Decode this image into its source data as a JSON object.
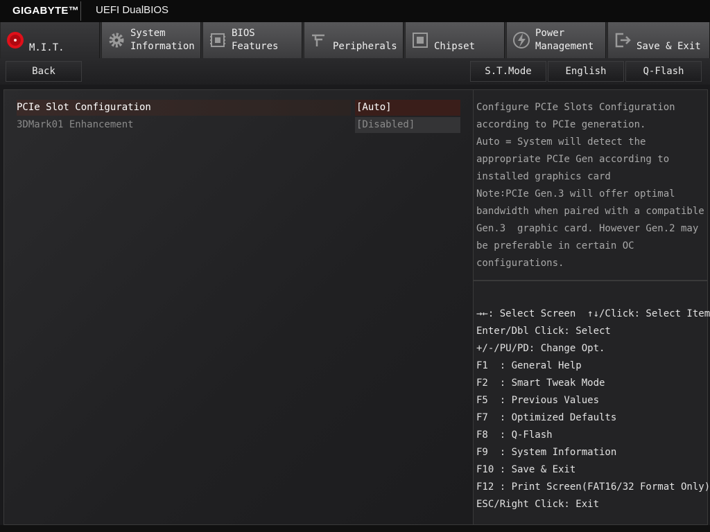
{
  "header": {
    "brand": "GIGABYTE™",
    "product": "UEFI DualBIOS"
  },
  "tabs": [
    {
      "label": "M.I.T.",
      "icon": "mit-dial-icon"
    },
    {
      "label": "System\nInformation",
      "icon": "gear-icon"
    },
    {
      "label": "BIOS\nFeatures",
      "icon": "bios-chip-icon"
    },
    {
      "label": "Peripherals",
      "icon": "peripherals-icon"
    },
    {
      "label": "Chipset",
      "icon": "chipset-icon"
    },
    {
      "label": "Power\nManagement",
      "icon": "power-icon"
    },
    {
      "label": "Save & Exit",
      "icon": "exit-icon"
    }
  ],
  "toolbar": {
    "back": "Back",
    "st_mode": "S.T.Mode",
    "language": "English",
    "qflash": "Q-Flash"
  },
  "settings": [
    {
      "name": "PCIe Slot Configuration",
      "value": "[Auto]"
    },
    {
      "name": "3DMark01 Enhancement",
      "value": "[Disabled]"
    }
  ],
  "help_text": "Configure PCIe Slots Configuration\naccording to PCIe generation.\nAuto = System will detect the\nappropriate PCIe Gen according to\ninstalled graphics card\nNote∶PCIe Gen.3 will offer optimal\nbandwidth when paired with a compatible\nGen.3  graphic card. However Gen.2 may\nbe preferable in certain OC\nconfigurations.",
  "key_help": [
    "→←: Select Screen  ↑↓/Click: Select Item",
    "Enter/Dbl Click: Select",
    "+/-/PU/PD: Change Opt.",
    "F1  : General Help",
    "F2  : Smart Tweak Mode",
    "F5  : Previous Values",
    "F7  : Optimized Defaults",
    "F8  : Q-Flash",
    "F9  : System Information",
    "F10 : Save & Exit",
    "F12 : Print Screen(FAT16/32 Format Only)",
    "ESC/Right Click: Exit"
  ],
  "colors": {
    "accent_red": "#e0101a",
    "selected_value_bg": "#3a1e1a"
  }
}
